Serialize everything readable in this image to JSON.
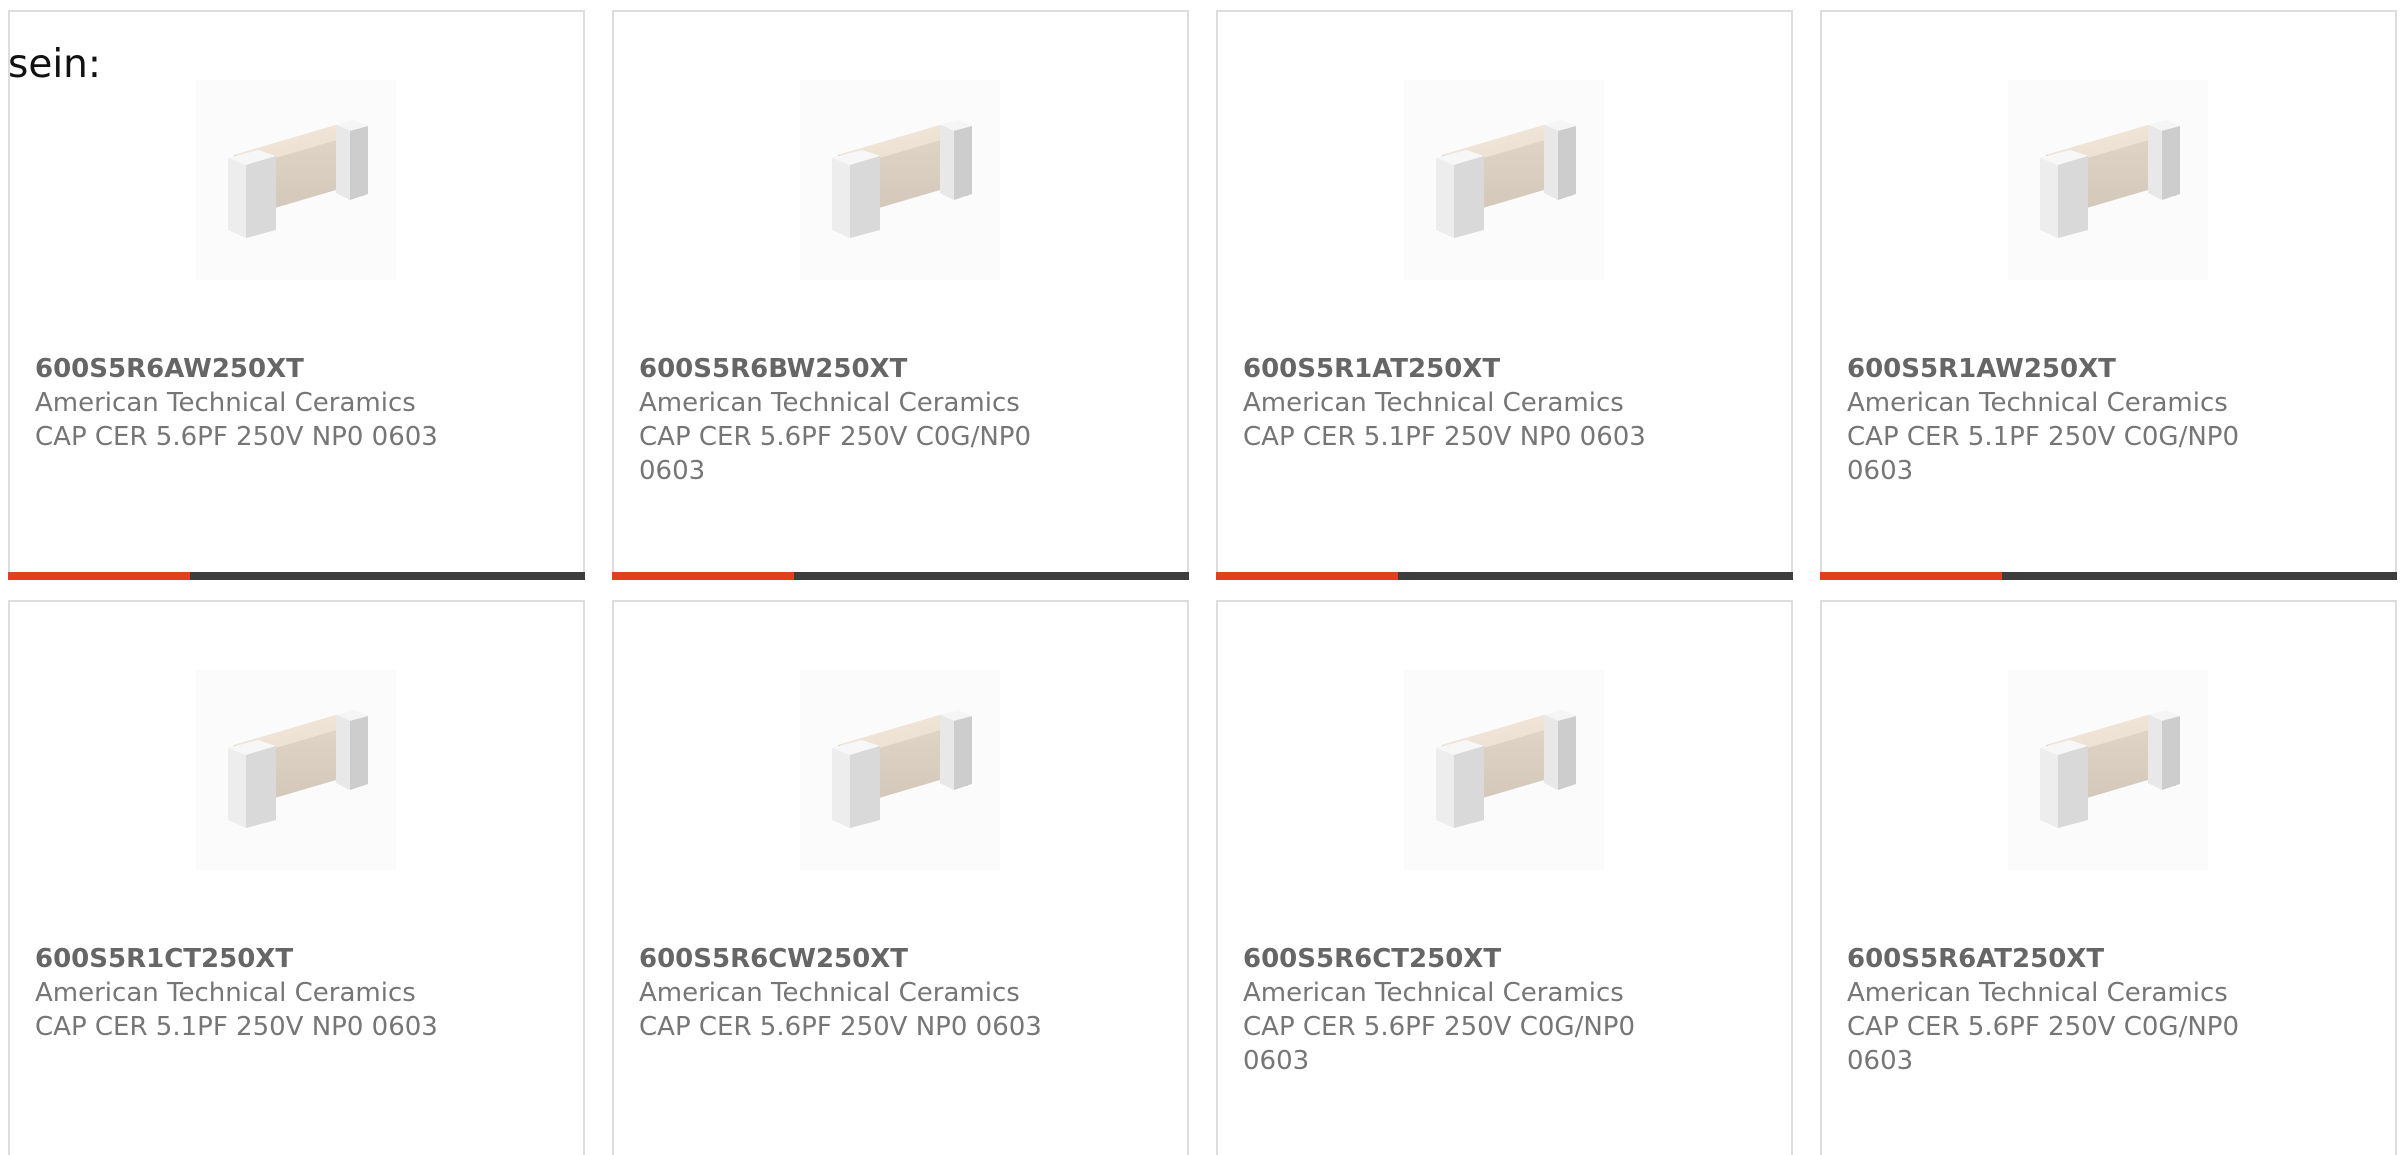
{
  "intro_text": "sein:",
  "accent_color": "#e0401b",
  "products": [
    {
      "part_number": "600S5R6AW250XT",
      "manufacturer": "American Technical Ceramics",
      "description": "CAP CER 5.6PF 250V NP0 0603"
    },
    {
      "part_number": "600S5R6BW250XT",
      "manufacturer": "American Technical Ceramics",
      "description": "CAP CER 5.6PF 250V C0G/NP0 0603"
    },
    {
      "part_number": "600S5R1AT250XT",
      "manufacturer": "American Technical Ceramics",
      "description": "CAP CER 5.1PF 250V NP0 0603"
    },
    {
      "part_number": "600S5R1AW250XT",
      "manufacturer": "American Technical Ceramics",
      "description": "CAP CER 5.1PF 250V C0G/NP0 0603"
    },
    {
      "part_number": "600S5R1CT250XT",
      "manufacturer": "American Technical Ceramics",
      "description": "CAP CER 5.1PF 250V NP0 0603"
    },
    {
      "part_number": "600S5R6CW250XT",
      "manufacturer": "American Technical Ceramics",
      "description": "CAP CER 5.6PF 250V NP0 0603"
    },
    {
      "part_number": "600S5R6CT250XT",
      "manufacturer": "American Technical Ceramics",
      "description": "CAP CER 5.6PF 250V C0G/NP0 0603"
    },
    {
      "part_number": "600S5R6AT250XT",
      "manufacturer": "American Technical Ceramics",
      "description": "CAP CER 5.6PF 250V C0G/NP0 0603"
    }
  ],
  "product_image_icon": "ceramic-capacitor-chip-icon"
}
